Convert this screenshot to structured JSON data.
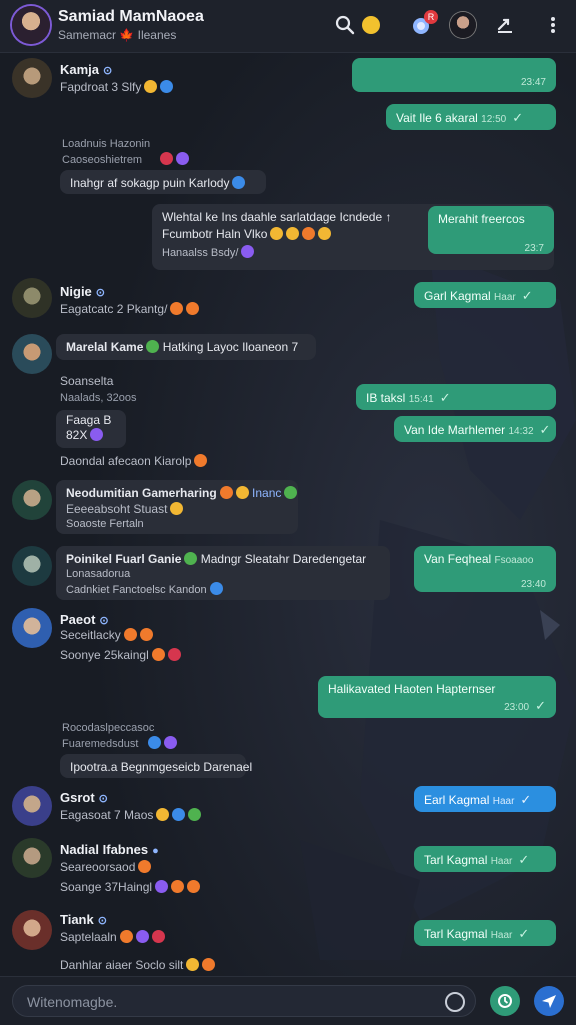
{
  "header": {
    "title": "Samiad MamNaoea",
    "subtitle": "Samemacr 🍁 Ileanes",
    "notification_count": "R"
  },
  "messages": [
    {
      "type": "in",
      "sender": "Kamja",
      "id": "⊙",
      "sub": "Fapdroat 3 Slfy"
    },
    {
      "type": "out",
      "text": "",
      "time": "23:47"
    },
    {
      "type": "out",
      "text": "Vait Ile 6 akaral",
      "time": "12:50"
    },
    {
      "type": "system",
      "line1": "Loadnuis Hazonin",
      "line2": "Caoseoshietrem"
    },
    {
      "type": "in",
      "text": "Inahgr af sokagp puin Karlody"
    },
    {
      "type": "in",
      "text": "Wlehtal ke Ins daahle sarlatdage Icndede ↑",
      "text2": "Fcumbotr Haln Vlko",
      "sub": "Hanaalss Bsdy/"
    },
    {
      "type": "out",
      "text": "Merahit freercos",
      "time": "23:7"
    },
    {
      "type": "in",
      "sender": "Nigie",
      "id": "⊙",
      "sub": "Eagatcatc 2 Pkantg/"
    },
    {
      "type": "out",
      "text": "Garl Kagmal",
      "time": "Haar"
    },
    {
      "type": "in",
      "sender": "Marelal Kame",
      "text": "Hatking Layoc Iloaneon 7",
      "sub": "Soanselta",
      "sub2": "Naalads, 32oos"
    },
    {
      "type": "out",
      "text": "IB taksl",
      "time": "15:41"
    },
    {
      "type": "in",
      "text": "Faaga B",
      "text2": "82X"
    },
    {
      "type": "out",
      "text": "Van Ide Marhlemer",
      "time": "14:32"
    },
    {
      "type": "in",
      "text": "Daondal afecaon Kiarolp"
    },
    {
      "type": "in",
      "sender": "Neodumitian Gamerharing",
      "text": "Inanc",
      "sub": "Eeeeabsoht Stuast",
      "sub2": "Soaoste Fertaln"
    },
    {
      "type": "in",
      "sender": "Poinikel Fuarl Ganie",
      "text": "Madngr Sleatahr Daredengetar",
      "sub": "Lonasadorua",
      "sub2": "Cadnkiet Fanctoelsc Kandon"
    },
    {
      "type": "out",
      "text": "Van Feqheal",
      "text2": "Fsoaaoo",
      "time": "23:40"
    },
    {
      "type": "in",
      "sender": "Paeot",
      "id": "⊙",
      "sub": "Seceitlacky",
      "sub2": "Soonye 25kaingl"
    },
    {
      "type": "out",
      "text": "Halikavated Haoten Hapternser",
      "time": "23:00"
    },
    {
      "type": "system",
      "line1": "Rocodaslpeccasoc",
      "line2": "Fuaremedsdust"
    },
    {
      "type": "in",
      "text": "Ipootra.a Begnmgeseicb Darenael"
    },
    {
      "type": "in",
      "sender": "Gsrot",
      "id": "⊙",
      "sub": "Eagasoat 7 Maos"
    },
    {
      "type": "blue",
      "text": "Earl Kagmal",
      "time": "Haar"
    },
    {
      "type": "in",
      "sender": "Nadial Ifabnes",
      "sub": "Seareoorsaod",
      "sub2": "Soange 37Haingl"
    },
    {
      "type": "out",
      "text": "Tarl Kagmal",
      "time": "Haar"
    },
    {
      "type": "in",
      "sender": "Tiank",
      "id": "⊙",
      "sub": "Saptelaaln",
      "sub2": "Danhlar aiaer Soclo silt"
    },
    {
      "type": "out",
      "text": "Tarl Kagmal",
      "time": "Haar"
    }
  ],
  "composer": {
    "placeholder": "Witenomagbe."
  },
  "colors": {
    "background": "#181c24",
    "bubble_out": "#2f9b78",
    "bubble_in": "#2a2e38",
    "bubble_blue": "#2b8fe0",
    "accent_badge": "#e0393e"
  },
  "icons": [
    "search-icon",
    "bell-icon",
    "notification-icon",
    "profile-icon",
    "share-icon",
    "more-icon",
    "emoji-icon",
    "camera-icon",
    "send-icon"
  ]
}
